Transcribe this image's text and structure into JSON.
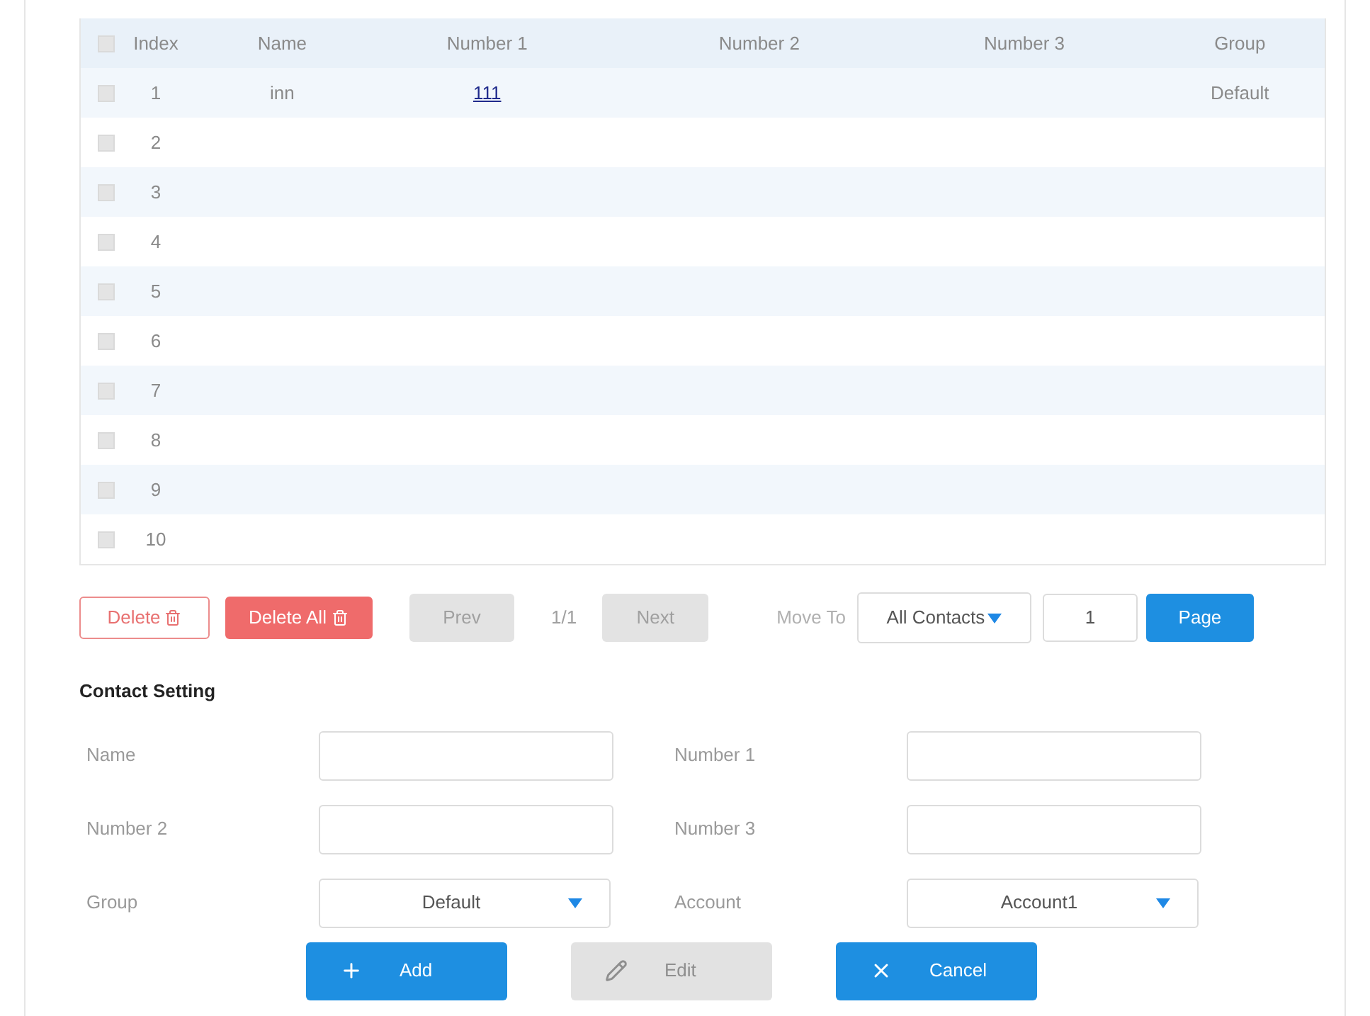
{
  "table": {
    "select_all": {
      "checked": false
    },
    "columns": [
      "Index",
      "Name",
      "Number 1",
      "Number 2",
      "Number 3",
      "Group"
    ],
    "rows": [
      {
        "index": "1",
        "name": "inn",
        "number_1": "111",
        "group": "Default",
        "checked": false
      },
      {
        "index": "2",
        "checked": false
      },
      {
        "index": "3",
        "checked": false
      },
      {
        "index": "4",
        "checked": false
      },
      {
        "index": "5",
        "checked": false
      },
      {
        "index": "6",
        "checked": false
      },
      {
        "index": "7",
        "checked": false
      },
      {
        "index": "8",
        "checked": false
      },
      {
        "index": "9",
        "checked": false
      },
      {
        "index": "10",
        "checked": false
      }
    ]
  },
  "toolbar": {
    "delete_button": {
      "label": "Delete"
    },
    "delete_all_button": {
      "label": "Delete All"
    },
    "prev_button": {
      "label": "Prev",
      "disabled": true
    },
    "page_indicator": "1/1",
    "next_button": {
      "label": "Next",
      "disabled": true
    },
    "move_to": {
      "label": "Move To",
      "select": "All Contacts",
      "page_field": "1",
      "page_button": "Page"
    }
  },
  "contact_setting": {
    "title": "Contact Setting",
    "fields": [
      {
        "kind": "text",
        "label": "Name"
      },
      {
        "kind": "text",
        "label": "Number 1"
      },
      {
        "kind": "text",
        "label": "Number 2"
      },
      {
        "kind": "text",
        "label": "Number 3"
      },
      {
        "kind": "select",
        "label": "Group",
        "value": "Default"
      },
      {
        "kind": "select",
        "label": "Account",
        "value": "Account1"
      }
    ],
    "buttons": [
      {
        "kind": "add",
        "label": "Add",
        "disabled": false
      },
      {
        "kind": "edit",
        "label": "Edit",
        "disabled": true
      },
      {
        "kind": "cancel",
        "label": "Cancel",
        "disabled": false
      }
    ]
  }
}
